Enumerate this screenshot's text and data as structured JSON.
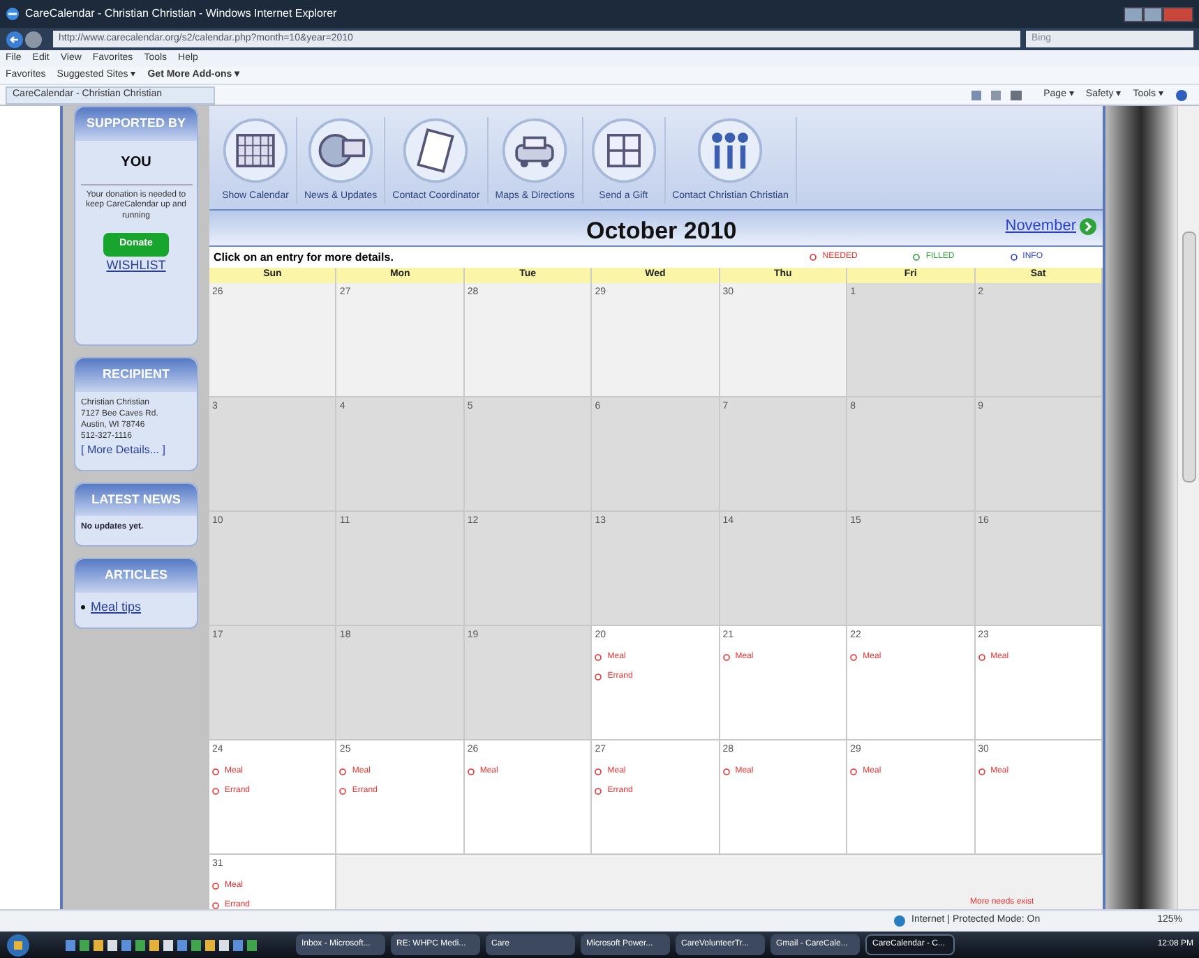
{
  "browser": {
    "title": "CareCalendar - Christian Christian - Windows Internet Explorer",
    "address": "http://www.carecalendar.org/s2/calendar.php?month=10&year=2010",
    "search_placeholder": "Bing",
    "menu": [
      "File",
      "Edit",
      "View",
      "Favorites",
      "Tools",
      "Help"
    ],
    "favorites": [
      "Favorites",
      "Suggested Sites ▾",
      "Get More Add-ons ▾"
    ],
    "tab": "CareCalendar - Christian Christian",
    "commands": [
      "Page ▾",
      "Safety ▾",
      "Tools ▾"
    ]
  },
  "sidebar": {
    "supported": {
      "title": "SUPPORTED BY",
      "who": "YOU",
      "message": "Your donation is needed to keep CareCalendar up and running",
      "donate": "Donate",
      "wishlist": "WISHLIST"
    },
    "recipient": {
      "title": "RECIPIENT",
      "lines": [
        "Christian Christian",
        "7127 Bee Caves Rd.",
        "Austin, WI 78746",
        "512-327-1116"
      ],
      "more": "[ More Details... ]"
    },
    "news": {
      "title": "LATEST NEWS",
      "text": "No updates yet."
    },
    "articles": {
      "title": "ARTICLES",
      "items": [
        "Meal tips"
      ]
    }
  },
  "nav": [
    "Show Calendar",
    "News & Updates",
    "Contact Coordinator",
    "Maps & Directions",
    "Send a Gift",
    "Contact Christian Christian"
  ],
  "calendar": {
    "month": "October 2010",
    "next": "November",
    "hint": "Click on an entry for more details.",
    "legend": [
      {
        "label": "NEEDED",
        "color": "#e8322f"
      },
      {
        "label": "FILLED",
        "color": "#2e9e3a"
      },
      {
        "label": "INFO",
        "color": "#2a3fd0"
      }
    ],
    "days": [
      "Sun",
      "Mon",
      "Tue",
      "Wed",
      "Thu",
      "Fri",
      "Sat"
    ],
    "weeks": [
      [
        {
          "day": "26",
          "kind": "other"
        },
        {
          "day": "27",
          "kind": "other"
        },
        {
          "day": "28",
          "kind": "other"
        },
        {
          "day": "29",
          "kind": "other"
        },
        {
          "day": "30",
          "kind": "other"
        },
        {
          "day": "1",
          "kind": "past"
        },
        {
          "day": "2",
          "kind": "past"
        }
      ],
      [
        {
          "day": "3",
          "kind": "past"
        },
        {
          "day": "4",
          "kind": "past"
        },
        {
          "day": "5",
          "kind": "past"
        },
        {
          "day": "6",
          "kind": "past"
        },
        {
          "day": "7",
          "kind": "past"
        },
        {
          "day": "8",
          "kind": "past"
        },
        {
          "day": "9",
          "kind": "past"
        }
      ],
      [
        {
          "day": "10",
          "kind": "past"
        },
        {
          "day": "11",
          "kind": "past"
        },
        {
          "day": "12",
          "kind": "past"
        },
        {
          "day": "13",
          "kind": "past"
        },
        {
          "day": "14",
          "kind": "past"
        },
        {
          "day": "15",
          "kind": "past"
        },
        {
          "day": "16",
          "kind": "past"
        }
      ],
      [
        {
          "day": "17",
          "kind": "past"
        },
        {
          "day": "18",
          "kind": "past"
        },
        {
          "day": "19",
          "kind": "past"
        },
        {
          "day": "20",
          "kind": "open",
          "items": [
            {
              "label": "Meal",
              "color": "#e8322f"
            },
            {
              "label": "Errand",
              "color": "#e8322f"
            }
          ]
        },
        {
          "day": "21",
          "kind": "open",
          "items": [
            {
              "label": "Meal",
              "color": "#e8322f"
            }
          ]
        },
        {
          "day": "22",
          "kind": "open",
          "items": [
            {
              "label": "Meal",
              "color": "#e8322f"
            }
          ]
        },
        {
          "day": "23",
          "kind": "open",
          "items": [
            {
              "label": "Meal",
              "color": "#e8322f"
            }
          ]
        }
      ],
      [
        {
          "day": "24",
          "kind": "open",
          "items": [
            {
              "label": "Meal",
              "color": "#e8322f"
            },
            {
              "label": "Errand",
              "color": "#e8322f"
            }
          ]
        },
        {
          "day": "25",
          "kind": "open",
          "items": [
            {
              "label": "Meal",
              "color": "#e8322f"
            },
            {
              "label": "Errand",
              "color": "#e8322f"
            }
          ]
        },
        {
          "day": "26",
          "kind": "open",
          "items": [
            {
              "label": "Meal",
              "color": "#e8322f"
            }
          ]
        },
        {
          "day": "27",
          "kind": "open",
          "items": [
            {
              "label": "Meal",
              "color": "#e8322f"
            },
            {
              "label": "Errand",
              "color": "#e8322f"
            }
          ]
        },
        {
          "day": "28",
          "kind": "open",
          "items": [
            {
              "label": "Meal",
              "color": "#e8322f"
            }
          ]
        },
        {
          "day": "29",
          "kind": "open",
          "items": [
            {
              "label": "Meal",
              "color": "#e8322f"
            }
          ]
        },
        {
          "day": "30",
          "kind": "open",
          "items": [
            {
              "label": "Meal",
              "color": "#e8322f"
            }
          ]
        }
      ],
      [
        {
          "day": "31",
          "kind": "open",
          "items": [
            {
              "label": "Meal",
              "color": "#e8322f"
            },
            {
              "label": "Errand",
              "color": "#e8322f"
            }
          ]
        }
      ]
    ],
    "footnote": "More needs exist"
  },
  "status_bar": {
    "zone": "Internet | Protected Mode: On",
    "zoom": "125%"
  },
  "taskbar": {
    "items": [
      {
        "label": "Inbox - Microsoft...",
        "selected": false
      },
      {
        "label": "RE: WHPC Medi...",
        "selected": false
      },
      {
        "label": "Care",
        "selected": false
      },
      {
        "label": "Microsoft Power...",
        "selected": false
      },
      {
        "label": "CareVolunteerTr...",
        "selected": false
      },
      {
        "label": "Gmail - CareCale...",
        "selected": false
      },
      {
        "label": "CareCalendar - C...",
        "selected": true
      }
    ],
    "clock": "12:08 PM"
  }
}
